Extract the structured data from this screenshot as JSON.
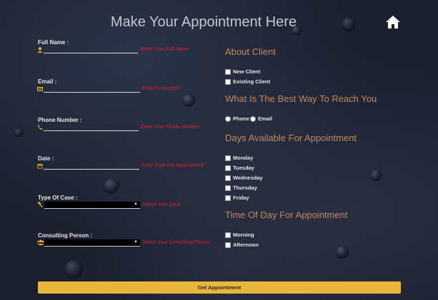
{
  "page": {
    "title": "Make Your Appointment Here",
    "home_icon": "home-icon"
  },
  "form": {
    "full_name": {
      "label": "Full Name :",
      "icon": "user-icon",
      "value": "",
      "error": "Enter Your Full Name"
    },
    "email": {
      "label": "Email :",
      "icon": "envelope-icon",
      "value": "",
      "error": "Email is required"
    },
    "phone": {
      "label": "Phone Number :",
      "icon": "phone-icon",
      "value": "",
      "error": "Enter Your Phone Number"
    },
    "date": {
      "label": "Date :",
      "icon": "calendar-icon",
      "value": "",
      "error": "Enter Date For Appointment"
    },
    "case_type": {
      "label": "Type Of Case :",
      "icon": "gavel-icon",
      "selected": "",
      "error": "Select Your Case"
    },
    "consulting_person": {
      "label": "Consulting Person :",
      "icon": "users-icon",
      "selected": "",
      "error": "Select Your Consulting Person"
    }
  },
  "about_client": {
    "heading": "About Client",
    "options": [
      "New Client",
      "Existing Client"
    ]
  },
  "reach": {
    "heading": "What Is The Best Way To Reach You",
    "options": [
      "Phone",
      "Email"
    ]
  },
  "days": {
    "heading": "Days Available For Appointment",
    "options": [
      "Monday",
      "Tuesday",
      "Wednesday",
      "Thursday",
      "Friday"
    ]
  },
  "time_of_day": {
    "heading": "Time Of Day For Appointment",
    "options": [
      "Morning",
      "Afternoon"
    ]
  },
  "submit": {
    "label": "Get Appointment"
  },
  "colors": {
    "accent": "#e7b63a",
    "heading": "#c2895e",
    "error": "#e0202c",
    "icon": "#e7b63a"
  }
}
